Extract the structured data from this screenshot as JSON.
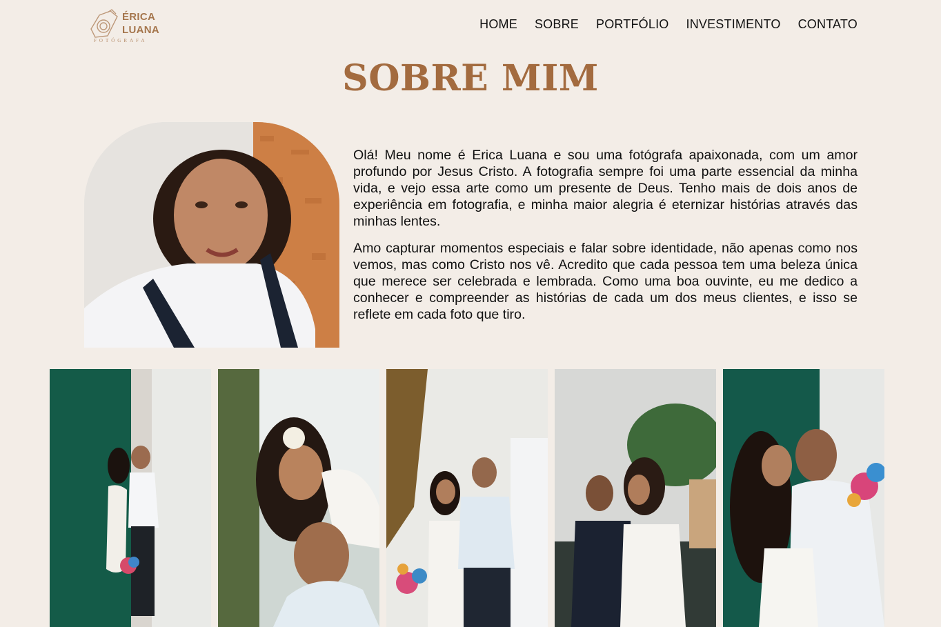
{
  "logo": {
    "name_line1": "ÉRICA",
    "name_line2": "LUANA",
    "subtitle": "FOTÓGRAFA",
    "icon": "camera-icon",
    "color": "#a5764d"
  },
  "nav": {
    "items": [
      "HOME",
      "SOBRE",
      "PORTFÓLIO",
      "INVESTIMENTO",
      "CONTATO"
    ]
  },
  "page": {
    "title": "SOBRE MIM",
    "title_color": "#a36b3f",
    "background": "#f3ede7"
  },
  "bio": {
    "paragraphs": [
      "Olá! Meu nome é Erica Luana e sou uma fotógrafa apaixonada, com um amor profundo por Jesus Cristo. A fotografia sempre foi uma parte essencial da minha vida, e vejo essa arte como um presente de Deus. Tenho mais de dois anos de experiência em fotografia, e minha maior alegria é eternizar histórias através das minhas lentes.",
      "Amo capturar momentos especiais e falar sobre identidade, não apenas como nos vemos, mas como Cristo nos vê. Acredito que cada pessoa tem uma beleza única que merece ser celebrada e lembrada. Como uma boa ouvinte, eu me dedico a conhecer e compreender as histórias de cada um dos meus clientes, e isso se reflete em cada foto que tiro."
    ]
  },
  "gallery": {
    "count": 5
  }
}
